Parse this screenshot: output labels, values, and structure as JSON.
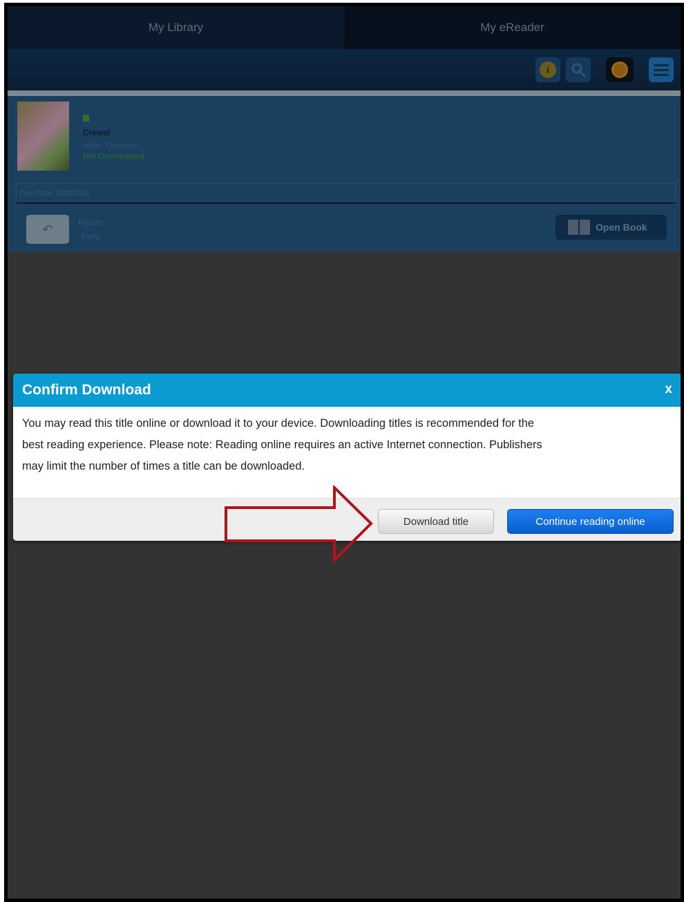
{
  "tabs": [
    {
      "label": "My Library"
    },
    {
      "label": "My eReader"
    }
  ],
  "toolbar": {
    "icons": [
      "info-icon",
      "search-icon",
      "sync-icon",
      "menu-icon"
    ]
  },
  "book": {
    "title": "Crewel",
    "author": "Albin, Gennifer",
    "status": "Not Downloaded",
    "due_date": "Due Date: 9/20/2014",
    "return_label_line1": "Return",
    "return_label_line2": "Early",
    "open_book_label": "Open Book"
  },
  "dialog": {
    "title": "Confirm Download",
    "close_label": "x",
    "body_lines": [
      "You may read this title online or download it to your device. Downloading titles is recommended for the",
      "best reading experience. Please note: Reading online requires an active Internet connection. Publishers",
      "may limit the number of times a title can be downloaded."
    ],
    "download_button": "Download title",
    "continue_button": "Continue reading online"
  },
  "colors": {
    "dialog_header": "#0a9bd1",
    "primary_button": "#1d7ff0",
    "annotation_arrow": "#b5121b",
    "background": "#333333"
  }
}
